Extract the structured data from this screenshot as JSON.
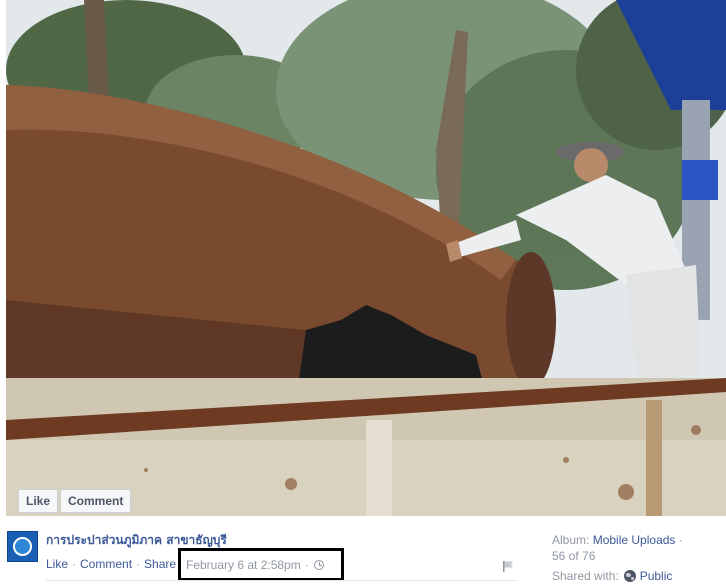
{
  "photo": {
    "alt": "",
    "like_label": "Like",
    "comment_label": "Comment"
  },
  "post": {
    "owner_name": "การประปาส่วนภูมิภาค สาขาธัญบุรี",
    "like_label": "Like",
    "comment_label": "Comment",
    "share_label": "Share",
    "separator": "·",
    "timestamp": "February 6 at 2:58pm",
    "timestamp_separator": "·"
  },
  "album": {
    "prefix": "Album:",
    "name": "Mobile Uploads",
    "name_suffix": "·",
    "position": "56 of 76"
  },
  "sharing": {
    "prefix": "Shared with:",
    "audience": "Public"
  },
  "icons": {
    "clock": "clock-icon",
    "globe": "globe-icon",
    "flag": "flag-icon",
    "logo": "page-logo"
  },
  "colors": {
    "link": "#3b5998",
    "muted": "#9197a3",
    "highlight_box": "#000000"
  }
}
